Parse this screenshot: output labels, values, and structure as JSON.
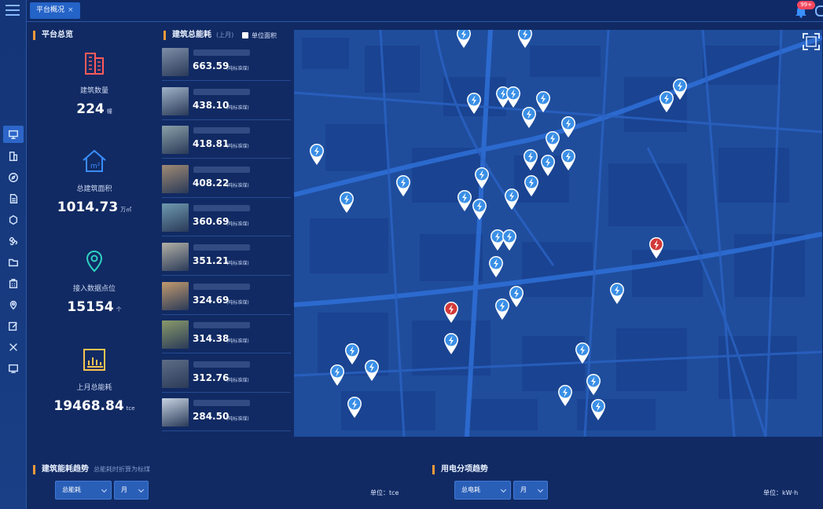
{
  "topbar": {
    "tab_label": "平台概况",
    "tab_close": "×",
    "notification_count": "99+"
  },
  "overview": {
    "title": "平台总览",
    "items": [
      {
        "label": "建筑数量",
        "value": "224",
        "unit": "幢",
        "icon": "building-icon",
        "color": "#ff5a5a"
      },
      {
        "label": "总建筑面积",
        "value": "1014.73",
        "unit": "万㎡",
        "icon": "area-house-icon",
        "color": "#3a8dff"
      },
      {
        "label": "接入数据点位",
        "value": "15154",
        "unit": "个",
        "icon": "location-icon",
        "color": "#2ed1c0"
      },
      {
        "label": "上月总能耗",
        "value": "19468.84",
        "unit": "tce",
        "icon": "chart-icon",
        "color": "#f5c451"
      }
    ]
  },
  "energy": {
    "title": "建筑总能耗",
    "subtitle": "(上月)",
    "checkbox_label": "单位面积",
    "rows": [
      {
        "value": "663.59",
        "unit": "(吨标准煤)"
      },
      {
        "value": "438.10",
        "unit": "(吨标准煤)"
      },
      {
        "value": "418.81",
        "unit": "(吨标准煤)"
      },
      {
        "value": "408.22",
        "unit": "(吨标准煤)"
      },
      {
        "value": "360.69",
        "unit": "(吨标准煤)"
      },
      {
        "value": "351.21",
        "unit": "(吨标准煤)"
      },
      {
        "value": "324.69",
        "unit": "(吨标准煤)"
      },
      {
        "value": "314.38",
        "unit": "(吨标准煤)"
      },
      {
        "value": "312.76",
        "unit": "(吨标准煤)"
      },
      {
        "value": "284.50",
        "unit": "(吨标准煤)"
      }
    ]
  },
  "trend": {
    "title": "建筑能耗趋势",
    "subtitle": "总能耗时折算为标煤",
    "select_type": "总能耗",
    "select_period": "月",
    "unit_label": "单位：",
    "unit_value": "tce"
  },
  "power": {
    "title": "用电分项趋势",
    "select_type": "总电耗",
    "select_period": "月",
    "unit_label": "单位：",
    "unit_value": "kW·h"
  },
  "colors": {
    "accent": "#f59a3a",
    "pin_blue": "#3a8fe6",
    "pin_red": "#d33a3a"
  }
}
